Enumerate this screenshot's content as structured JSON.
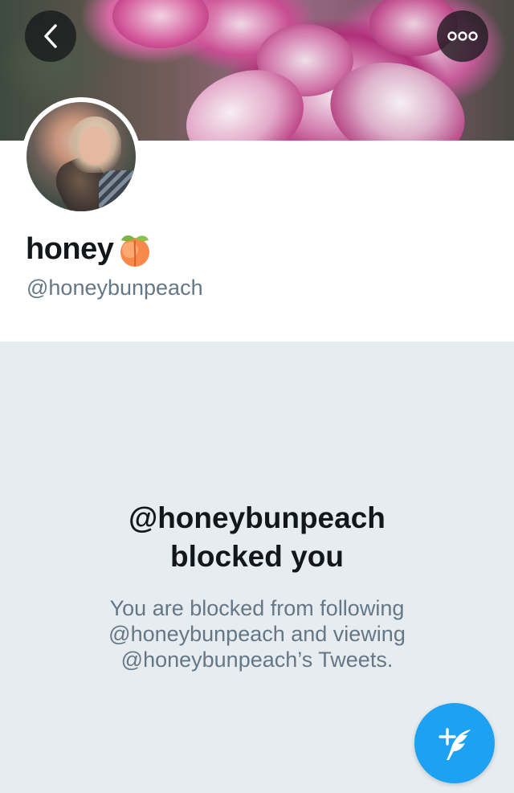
{
  "header": {
    "back_icon": "chevron-left-icon",
    "more_icon": "more-options-icon"
  },
  "profile": {
    "display_name": "honey",
    "name_emoji": "peach-icon",
    "handle": "@honeybunpeach"
  },
  "blocked": {
    "title_line1": "@honeybunpeach",
    "title_line2": "blocked you",
    "description_line1": "You are blocked from following",
    "description_line2": "@honeybunpeach and viewing",
    "description_line3": "@honeybunpeach’s Tweets."
  },
  "compose": {
    "icon": "compose-tweet-icon"
  },
  "colors": {
    "accent": "#1da1f2",
    "background": "#e6ecf0",
    "text_primary": "#14171a",
    "text_secondary": "#657786"
  }
}
